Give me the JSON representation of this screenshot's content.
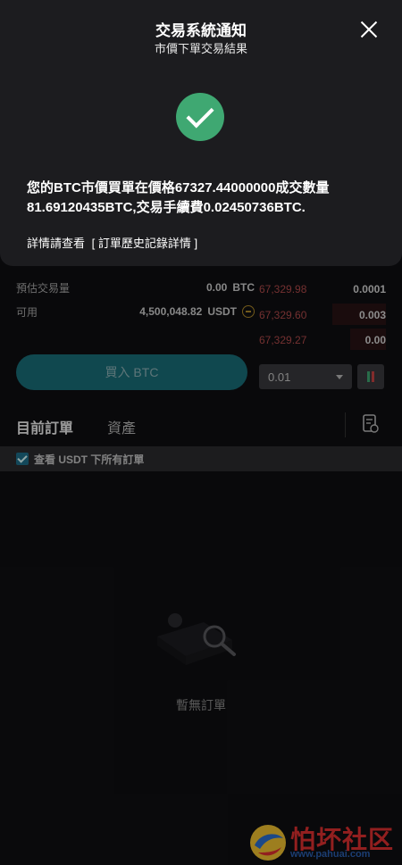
{
  "modal": {
    "title": "交易系統通知",
    "subtitle": "市價下單交易結果",
    "message_line1": "您的BTC市價買單在價格67327.44000000成交數量",
    "message_line2": "81.69120435BTC,交易手續費0.02450736BTC.",
    "detail_prefix": "詳情請查看",
    "detail_link": "[ 訂單歷史記錄詳情 ]"
  },
  "trade": {
    "estimate_label": "預估交易量",
    "estimate_value": "0.00",
    "estimate_unit": "BTC",
    "available_label": "可用",
    "available_value": "4,500,048.82",
    "available_unit": "USDT",
    "buy_button": "買入 BTC",
    "depth_value": "0.01"
  },
  "orderbook": [
    {
      "price": "67,329.98",
      "qty": "0.0001"
    },
    {
      "price": "67,329.60",
      "qty": "0.003"
    },
    {
      "price": "67,329.27",
      "qty": "0.00"
    }
  ],
  "orders": {
    "tab_current": "目前訂單",
    "tab_assets": "資產",
    "filter_label": "查看 USDT 下所有訂單",
    "empty_text": "暫無訂單"
  },
  "watermark": {
    "text": "怕坏社区",
    "url": "www.pahuai.com"
  },
  "colors": {
    "success": "#3fa872",
    "buy": "#1a6f7a",
    "ask_price": "#b24b4b"
  }
}
